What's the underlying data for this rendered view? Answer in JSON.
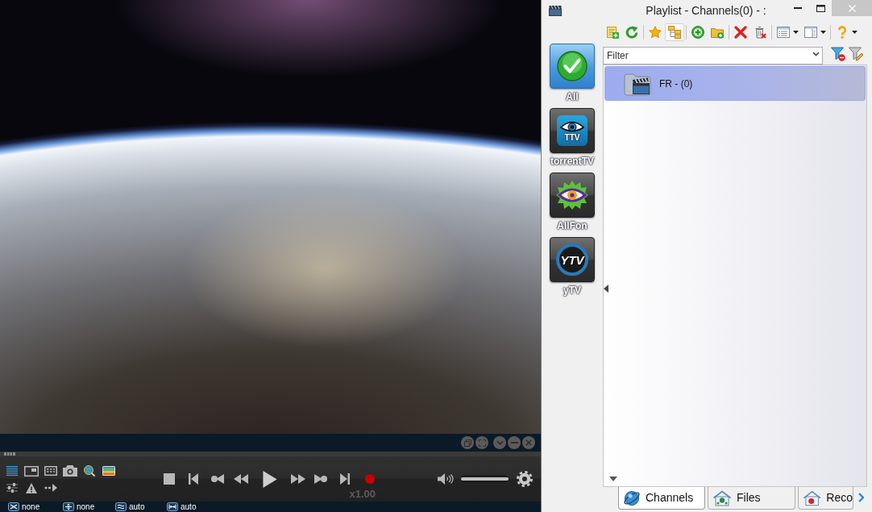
{
  "player": {
    "playlist_shown": true,
    "speed": "x1.00",
    "volume": {
      "level": 1
    },
    "status": [
      {
        "value": "none"
      },
      {
        "value": "none"
      },
      {
        "value": "auto"
      },
      {
        "value": "auto"
      }
    ]
  },
  "playlist": {
    "window": {
      "title": "Playlist - Channels(0) - :"
    },
    "toolbar": [
      {
        "pressed": false
      },
      {
        "pressed": false
      },
      {
        "pressed": false
      },
      {
        "pressed": true
      },
      {
        "pressed": false
      },
      {
        "pressed": false
      },
      {
        "pressed": false
      },
      {
        "pressed": false
      },
      {
        "pressed": false
      },
      {
        "pressed": false
      },
      {
        "pressed": false
      }
    ],
    "filter": {
      "placeholder": "Filter"
    },
    "categories": [
      {
        "label": "All",
        "selected": true
      },
      {
        "label": "torrentTV",
        "selected": false,
        "logo_text": "TTV"
      },
      {
        "label": "AllFon",
        "selected": false
      },
      {
        "label": "yTV",
        "selected": false,
        "logo_text": "YTV"
      }
    ],
    "groups": [
      {
        "label": "FR - (0)",
        "selected": true
      }
    ],
    "tabs": [
      {
        "label": "Channels",
        "selected": true
      },
      {
        "label": "Files",
        "selected": false
      },
      {
        "label": "Reco",
        "selected": false
      }
    ]
  }
}
